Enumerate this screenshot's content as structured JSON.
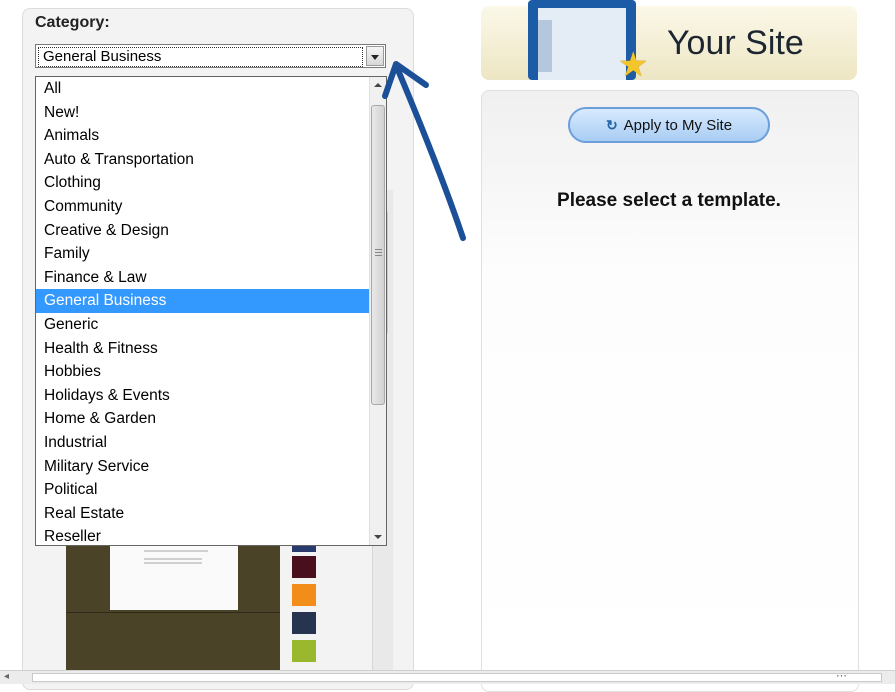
{
  "category": {
    "label": "Category:",
    "selected": "General Business",
    "options": [
      "All",
      "New!",
      "Animals",
      "Auto & Transportation",
      "Clothing",
      "Community",
      "Creative & Design",
      "Family",
      "Finance & Law",
      "General Business",
      "Generic",
      "Health & Fitness",
      "Hobbies",
      "Holidays & Events",
      "Home & Garden",
      "Industrial",
      "Military Service",
      "Political",
      "Real Estate",
      "Reseller"
    ],
    "selected_index": 9
  },
  "header": {
    "title": "Your Site"
  },
  "preview": {
    "apply_button": "Apply to My Site",
    "message": "Please select a template."
  },
  "swatches": [
    "#2b3a6e",
    "#4a0f1d",
    "#f28c1a",
    "#26344f",
    "#9ab82e"
  ],
  "colors": {
    "selection": "#3399ff",
    "annotation_arrow": "#1b4f97",
    "header_icon": "#1c5ba6",
    "thumbnail_bg": "#4a4328"
  }
}
